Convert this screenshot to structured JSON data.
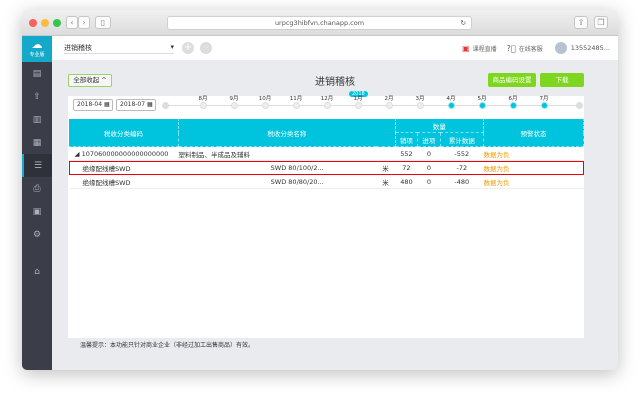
{
  "browser": {
    "url": "urpcg3hibfvn.chanapp.com"
  },
  "sidebar": {
    "logo_label": "专业版",
    "icons": [
      "panel-icon",
      "upload-icon",
      "chart-icon",
      "report-icon",
      "audit-icon",
      "stamp-icon",
      "document-icon",
      "settings-icon",
      "basket-icon"
    ]
  },
  "header": {
    "module_select": "进销稽核",
    "live_course": "课程直播",
    "online_support": "在线客服",
    "user": "13552485..."
  },
  "toolbar": {
    "collapse_all": "全部收起",
    "title": "进销稽核",
    "code_settings": "商品编码设置",
    "download": "下载"
  },
  "date_range": {
    "start": "2018-04",
    "end": "2018-07"
  },
  "timeline": {
    "year_badge": "2018",
    "months": [
      "8月",
      "9月",
      "10月",
      "11月",
      "12月",
      "1月",
      "2月",
      "3月",
      "4月",
      "5月",
      "6月",
      "7月"
    ],
    "selected": [
      false,
      false,
      false,
      false,
      false,
      false,
      false,
      false,
      true,
      true,
      true,
      true
    ]
  },
  "table": {
    "headers": {
      "code": "税收分类编码",
      "name": "税收分类名称",
      "quantity": "数量",
      "sales": "销项",
      "purchase": "进项",
      "cumulative": "累计数据",
      "warning": "预警状态"
    },
    "group": {
      "code": "107060000000000000000",
      "name": "塑料制品、半成品及辅料",
      "sales": "552",
      "purchase": "0",
      "cumulative": "-552",
      "warning": "数据为负"
    },
    "rows": [
      {
        "name": "绝缘配线槽SWD",
        "spec": "SWD 80/100/2...",
        "unit": "米",
        "sales": "72",
        "purchase": "0",
        "cumulative": "-72",
        "warning": "数据为负"
      },
      {
        "name": "绝缘配线槽SWD",
        "spec": "SWD 80/80/20...",
        "unit": "米",
        "sales": "480",
        "purchase": "0",
        "cumulative": "-480",
        "warning": "数据为负"
      }
    ]
  },
  "footer": {
    "tip": "温馨提示：本功能只针对商业企业（非经过加工出售商品）有效。"
  }
}
